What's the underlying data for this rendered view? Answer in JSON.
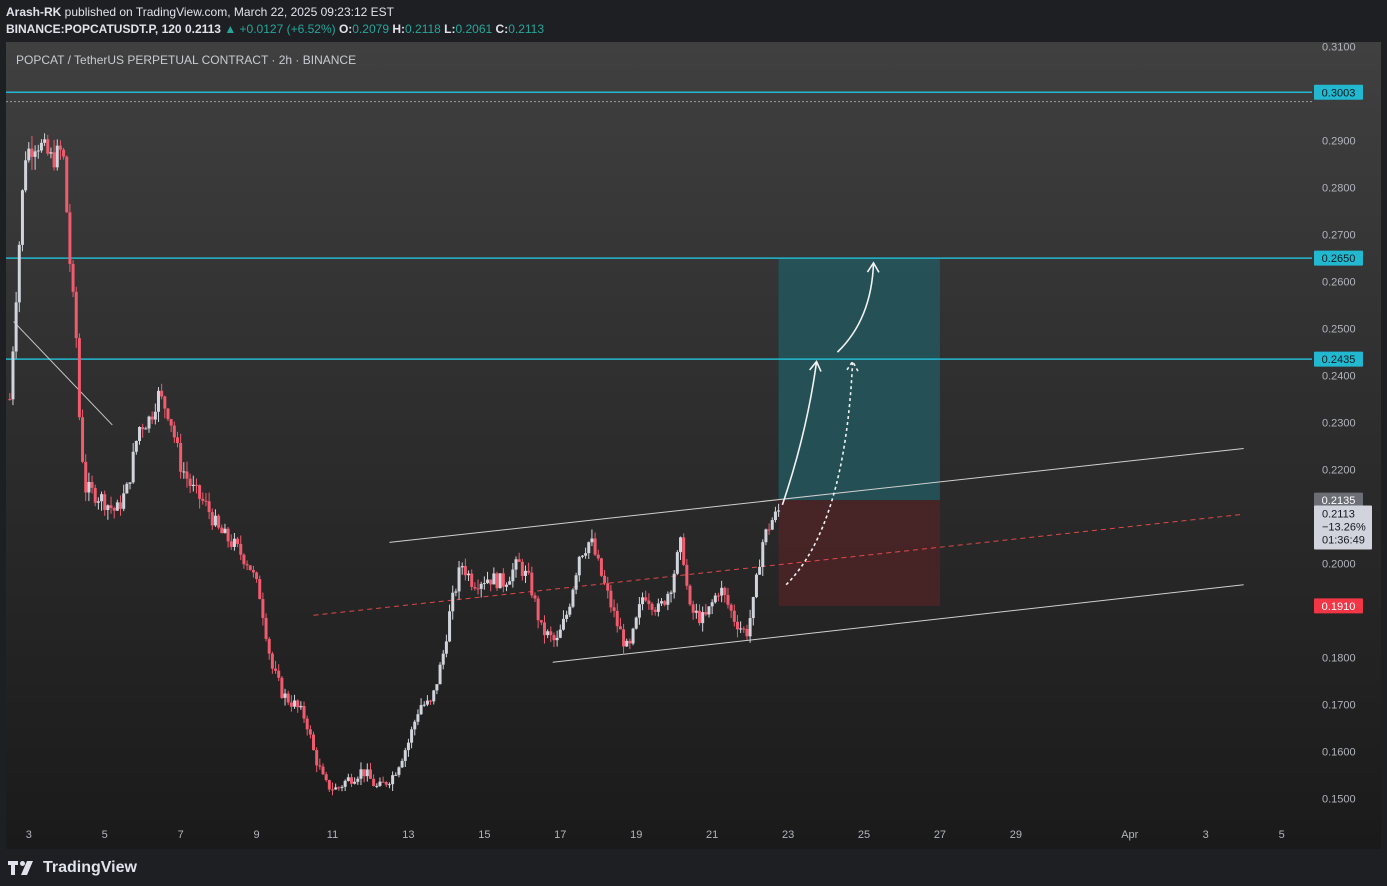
{
  "header": {
    "line1_author": "Arash-RK",
    "line1_rest": " published on TradingView.com, March 22, 2025 09:23:12 EST",
    "symbol": "BINANCE:POPCATUSDT.P, 120",
    "price": "0.2113",
    "change": "▲ +0.0127 (+6.52%)",
    "o_label": "O:",
    "o": "0.2079",
    "h_label": "H:",
    "h": "0.2118",
    "l_label": "L:",
    "l": "0.2061",
    "c_label": "C:",
    "c": "0.2113"
  },
  "chart_title": "POPCAT / TetherUS PERPETUAL CONTRACT · 2h · BINANCE",
  "logo_text": "TradingView",
  "colors": {
    "up": "#d1d4dc",
    "down": "#f05b6e",
    "level_line": "#22b8cf",
    "stop_label": "#f23645",
    "target_zone": "#22565d",
    "stop_zone": "#4a2526"
  },
  "chart_data": {
    "type": "candlestick",
    "ylim": [
      0.145,
      0.311
    ],
    "y_ticks": [
      0.15,
      0.16,
      0.17,
      0.18,
      0.19,
      0.2,
      0.21,
      0.22,
      0.23,
      0.24,
      0.25,
      0.26,
      0.27,
      0.28,
      0.29,
      0.3,
      0.31
    ],
    "y_tick_labels": [
      "0.1500",
      "0.1600",
      "0.1700",
      "0.1800",
      "",
      "0.2000",
      "",
      "0.2200",
      "0.2300",
      "0.2400",
      "0.2500",
      "0.2600",
      "0.2700",
      "0.2800",
      "0.2900",
      "",
      "0.3100"
    ],
    "x_range_days": [
      2.4,
      36.8
    ],
    "x_ticks": [
      {
        "day": 3,
        "label": "3"
      },
      {
        "day": 5,
        "label": "5"
      },
      {
        "day": 7,
        "label": "7"
      },
      {
        "day": 9,
        "label": "9"
      },
      {
        "day": 11,
        "label": "11"
      },
      {
        "day": 13,
        "label": "13"
      },
      {
        "day": 15,
        "label": "15"
      },
      {
        "day": 17,
        "label": "17"
      },
      {
        "day": 19,
        "label": "19"
      },
      {
        "day": 21,
        "label": "21"
      },
      {
        "day": 23,
        "label": "23"
      },
      {
        "day": 25,
        "label": "25"
      },
      {
        "day": 27,
        "label": "27"
      },
      {
        "day": 29,
        "label": "29"
      },
      {
        "day": 32,
        "label": "Apr"
      },
      {
        "day": 34,
        "label": "3"
      },
      {
        "day": 36,
        "label": "5"
      }
    ],
    "path_points": [
      [
        2.5,
        0.235
      ],
      [
        2.7,
        0.262
      ],
      [
        2.9,
        0.287
      ],
      [
        3.2,
        0.29
      ],
      [
        3.6,
        0.286
      ],
      [
        3.9,
        0.288
      ],
      [
        4.1,
        0.262
      ],
      [
        4.25,
        0.248
      ],
      [
        4.35,
        0.228
      ],
      [
        4.5,
        0.216
      ],
      [
        4.9,
        0.214
      ],
      [
        5.3,
        0.211
      ],
      [
        5.6,
        0.216
      ],
      [
        5.9,
        0.229
      ],
      [
        6.2,
        0.231
      ],
      [
        6.4,
        0.236
      ],
      [
        6.7,
        0.232
      ],
      [
        7.0,
        0.221
      ],
      [
        7.3,
        0.216
      ],
      [
        7.7,
        0.212
      ],
      [
        8.0,
        0.207
      ],
      [
        8.4,
        0.204
      ],
      [
        8.8,
        0.2
      ],
      [
        9.1,
        0.193
      ],
      [
        9.4,
        0.178
      ],
      [
        9.7,
        0.172
      ],
      [
        10.0,
        0.17
      ],
      [
        10.3,
        0.167
      ],
      [
        10.5,
        0.16
      ],
      [
        10.8,
        0.153
      ],
      [
        11.1,
        0.152
      ],
      [
        11.4,
        0.154
      ],
      [
        11.8,
        0.156
      ],
      [
        12.2,
        0.152
      ],
      [
        12.6,
        0.155
      ],
      [
        13.0,
        0.162
      ],
      [
        13.3,
        0.17
      ],
      [
        13.6,
        0.17
      ],
      [
        13.9,
        0.18
      ],
      [
        14.1,
        0.19
      ],
      [
        14.4,
        0.2
      ],
      [
        14.7,
        0.196
      ],
      [
        15.1,
        0.197
      ],
      [
        15.5,
        0.196
      ],
      [
        15.9,
        0.2
      ],
      [
        16.2,
        0.196
      ],
      [
        16.5,
        0.186
      ],
      [
        16.9,
        0.183
      ],
      [
        17.2,
        0.19
      ],
      [
        17.5,
        0.202
      ],
      [
        17.8,
        0.205
      ],
      [
        18.1,
        0.197
      ],
      [
        18.5,
        0.187
      ],
      [
        18.8,
        0.181
      ],
      [
        19.2,
        0.194
      ],
      [
        19.6,
        0.19
      ],
      [
        19.9,
        0.195
      ],
      [
        20.2,
        0.205
      ],
      [
        20.4,
        0.19
      ],
      [
        20.8,
        0.188
      ],
      [
        21.2,
        0.195
      ],
      [
        21.6,
        0.188
      ],
      [
        21.9,
        0.185
      ],
      [
        22.1,
        0.192
      ],
      [
        22.3,
        0.204
      ],
      [
        22.55,
        0.209
      ],
      [
        22.8,
        0.2113
      ]
    ],
    "horizontal_levels": [
      {
        "value": 0.3003,
        "label": "0.3003"
      },
      {
        "value": 0.265,
        "label": "0.2650"
      },
      {
        "value": 0.2435,
        "label": "0.2435"
      }
    ],
    "stop_level": {
      "value": 0.191,
      "label": "0.1910"
    },
    "entry_level": {
      "value": 0.2135,
      "label": "0.2135"
    },
    "last_price": {
      "value": 0.2113,
      "label": "0.2113",
      "change": "−13.26%",
      "countdown": "01:36:49"
    },
    "position": {
      "start_day": 22.75,
      "end_day": 27.0,
      "entry": 0.2135,
      "target": 0.265,
      "stop": 0.191
    },
    "channel": {
      "upper": [
        [
          12.5,
          0.2045
        ],
        [
          35.0,
          0.2245
        ]
      ],
      "lower": [
        [
          16.8,
          0.179
        ],
        [
          35.0,
          0.1955
        ]
      ],
      "mid": [
        [
          10.5,
          0.189
        ],
        [
          35.0,
          0.2105
        ]
      ]
    },
    "trendline": [
      [
        2.6,
        0.2515
      ],
      [
        5.2,
        0.2295
      ]
    ],
    "arrows": [
      {
        "style": "solid",
        "from": [
          22.85,
          0.2125
        ],
        "ctrl": [
          23.5,
          0.228
        ],
        "to": [
          23.75,
          0.243
        ]
      },
      {
        "style": "solid",
        "from": [
          24.3,
          0.245
        ],
        "ctrl": [
          25.2,
          0.252
        ],
        "to": [
          25.25,
          0.264
        ]
      },
      {
        "style": "dotted",
        "from": [
          22.95,
          0.1955
        ],
        "ctrl": [
          24.5,
          0.208
        ],
        "to": [
          24.7,
          0.243
        ]
      }
    ]
  }
}
